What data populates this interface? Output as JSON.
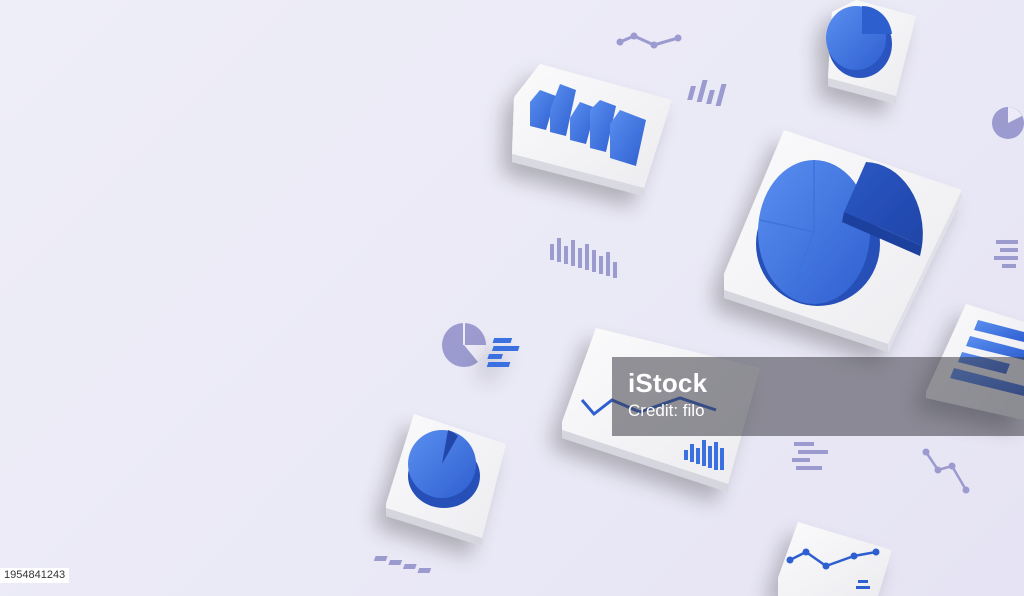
{
  "watermark": {
    "brand": "iStock",
    "credit": "Credit: filo"
  },
  "image_id": "1954841243",
  "colors": {
    "background": "#ecebf7",
    "tile": "#f4f4f6",
    "chart_blue": "#2f5fd0",
    "chart_blue_light": "#4b82e6",
    "icon_lavender": "#9b9bd0"
  }
}
